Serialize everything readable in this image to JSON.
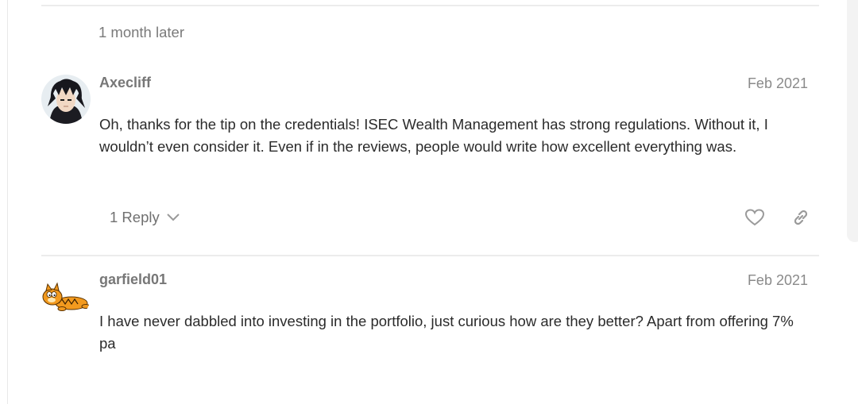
{
  "time_gap": "1 month later",
  "posts": [
    {
      "username": "Axecliff",
      "date": "Feb 2021",
      "body": "Oh, thanks for the tip on the credentials! ISEC Wealth Management has strong regulations. Without it, I wouldn’t even consider it. Even if in the reviews, people would write how excellent everything was.",
      "replies_label": "1 Reply",
      "avatar_icon": "anime-character-avatar",
      "actions": [
        "heart-icon",
        "link-icon"
      ]
    },
    {
      "username": "garfield01",
      "date": "Feb 2021",
      "body": "I have never dabbled into investing in the portfolio, just curious how are they better? Apart from offering 7% pa",
      "avatar_icon": "garfield-cat-avatar"
    }
  ],
  "colors": {
    "divider": "#ececec",
    "muted_text": "#777777",
    "body_text": "#2b2b2b",
    "icon": "#9a9a9a"
  }
}
